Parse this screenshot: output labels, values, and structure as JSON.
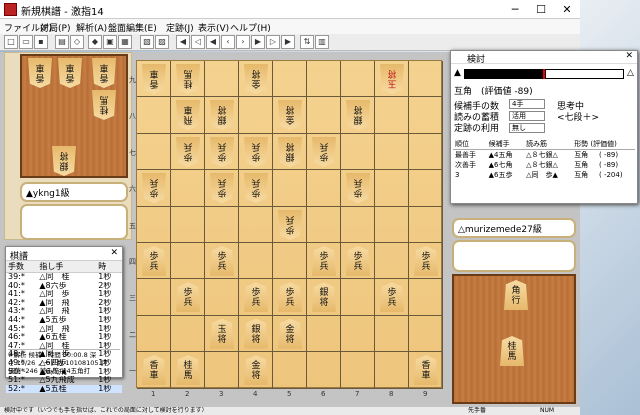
{
  "window": {
    "title": "新規棋譜 - 激指14"
  },
  "menu": [
    "ファイル(F)",
    "対局(P)",
    "解析(A)",
    "盤面編集(E)",
    "定跡(J)",
    "表示(V)",
    "ヘルプ(H)"
  ],
  "players": {
    "sente": "▲ykng1級",
    "gote": "△murizemede27級"
  },
  "kifu": {
    "title": "棋譜",
    "headers": [
      "手数",
      "指し手",
      "時"
    ],
    "rows": [
      [
        "39:*",
        "△同　桂",
        "1秒"
      ],
      [
        "40:*",
        "▲8六歩",
        "2秒"
      ],
      [
        "41:*",
        "△同　歩",
        "1秒"
      ],
      [
        "42:*",
        "▲同　飛",
        "2秒"
      ],
      [
        "43:*",
        "△同　飛",
        "1秒"
      ],
      [
        "44:*",
        "▲5五歩",
        "1秒"
      ],
      [
        "45:*",
        "△同　飛",
        "1秒"
      ],
      [
        "46:*",
        "▲6五桂",
        "1秒"
      ],
      [
        "47:*",
        "△同　桂",
        "1秒"
      ],
      [
        "48:*",
        "▲同　歩",
        "1秒"
      ],
      [
        "49:*",
        "△6四歩",
        "1秒"
      ],
      [
        "50:*",
        "▲6八飛",
        "1秒"
      ],
      [
        "51:*",
        "△5九飛成",
        "1秒"
      ],
      [
        "52:*",
        "▲5五桂",
        "1秒"
      ]
    ],
    "info": [
      "#解析 候補1 時間 00:00.8 深",
      "さ 19/26 ノード数 10108105 評",
      "価値 -246 読み筋 ▲4五角打"
    ]
  },
  "analysis": {
    "title": "検討",
    "sente_mark": "▲",
    "gote_mark": "△",
    "evaluation": "互角　(評価値 -89)",
    "labels": [
      "候補手の数",
      "読みの蓄積",
      "定跡の利用"
    ],
    "values": [
      "4手",
      "活用",
      "無し"
    ],
    "status": [
      "思考中",
      "<七段＋>"
    ],
    "cand_headers": [
      "順位",
      "候補手",
      "読み筋",
      "形勢 (評価値)"
    ],
    "cands": [
      [
        "最善手",
        "▲4五角",
        "△８七銀△",
        "互角",
        "( -89)"
      ],
      [
        "次善手",
        "▲6七角",
        "△８七銀△",
        "互角",
        "( -89)"
      ],
      [
        "3",
        "▲6五歩",
        "△同　歩▲",
        "互角",
        "( -204)"
      ]
    ]
  },
  "board_labels": {
    "ranks": [
      "九",
      "八",
      "七",
      "六",
      "五",
      "四",
      "三",
      "二",
      "一"
    ],
    "files": [
      "1",
      "2",
      "3",
      "4",
      "5",
      "6",
      "7",
      "8",
      "9"
    ]
  },
  "status_text": "検討中です（いつでも手を指せば、これでの局面に対して検討を行ります）",
  "status_buttons": [
    "先手番",
    "NUM"
  ]
}
